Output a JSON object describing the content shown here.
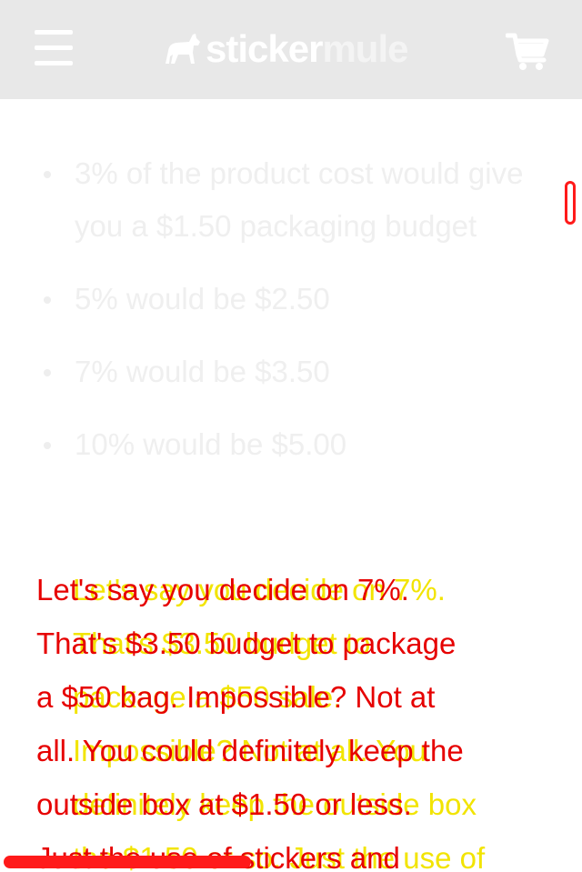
{
  "header": {
    "logo_word_1": "sticker",
    "logo_word_2": "mule",
    "menu_icon": "hamburger-menu-icon",
    "cart_icon": "shopping-cart-icon",
    "background_color": "#e8e8e8"
  },
  "list": {
    "items": [
      "3% of the product cost would give you a $1.50 packaging budget",
      "5% would be $2.50",
      "7% would be $3.50",
      "10% would be $5.00"
    ]
  },
  "paragraph": {
    "lines": [
      "Let's say you decide on 7%.",
      "That's $3.50 budget to package",
      "a $50 bag. Impossible? Not at",
      "all. You could definitely keep the",
      "outside box at $1.50 or less.",
      "Just the use of stickers and"
    ],
    "ghost_lines": [
      "Let's say you decide on 7%.",
      "That's $3.50 budget to",
      "package a $50 sale.",
      "Impossible? Not at all. You",
      "definitely keep the outside box",
      "the $1.50 or so. Just the use of"
    ],
    "primary_color": "#e60000",
    "ghost_color": "#f2e400"
  },
  "scrollbars": {
    "vertical_color": "#ff1a1a",
    "horizontal_color": "#ff1a1a"
  }
}
